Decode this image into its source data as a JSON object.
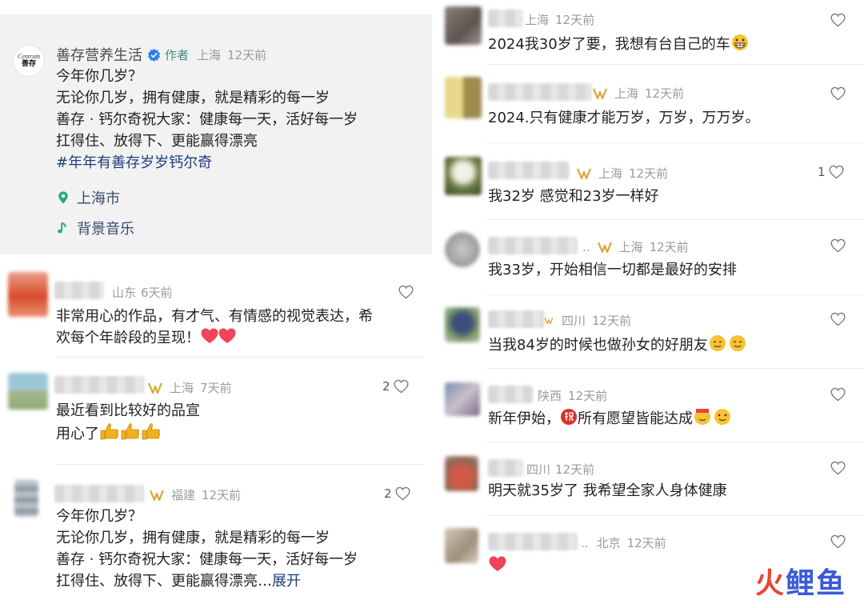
{
  "post": {
    "brand_logo": {
      "line1": "Centrum",
      "line2": "善存"
    },
    "author_name": "善存营养生活",
    "author_tag": "作者",
    "region": "上海",
    "time": "12天前",
    "lines": [
      "今年你几岁？",
      "无论你几岁，拥有健康，就是精彩的每一岁",
      "善存 · 钙尔奇祝大家：健康每一天，活好每一岁",
      "扛得住、放得下、更能赢得漂亮"
    ],
    "hashtag": "#年年有善存岁岁钙尔奇",
    "location": "上海市",
    "music": "背景音乐"
  },
  "left_comments": [
    {
      "region": "山东",
      "time": "6天前",
      "lines": [
        "非常用心的作品，有才气、有情感的视觉表达，希",
        "欢每个年龄段的呈现！"
      ],
      "likes": ""
    },
    {
      "region": "上海",
      "time": "7天前",
      "lines": [
        "最近看到比较好的品宣",
        "用心了"
      ],
      "likes": "2"
    },
    {
      "region": "福建",
      "time": "12天前",
      "lines": [
        "今年你几岁？",
        "无论你几岁，拥有健康，就是精彩的每一岁",
        "善存 · 钙尔奇祝大家：健康每一天，活好每一岁",
        "扛得住、放得下、更能赢得漂亮…"
      ],
      "expand": "展开",
      "likes": "2"
    }
  ],
  "right_comments": [
    {
      "region": "上海",
      "time": "12天前",
      "text": "2024我30岁了要，我想有台自己的车",
      "likes": ""
    },
    {
      "region": "上海",
      "time": "12天前",
      "text": "2024.只有健康才能万岁，万岁，万万岁。",
      "likes": ""
    },
    {
      "region": "上海",
      "time": "12天前",
      "text": "我32岁 感觉和23岁一样好",
      "likes": "1"
    },
    {
      "region": "上海",
      "time": "12天前",
      "prefix": "..",
      "text": "我33岁，开始相信一切都是最好的安排",
      "likes": ""
    },
    {
      "region": "四川",
      "time": "12天前",
      "text": "当我84岁的时候也做孙女的好朋友",
      "likes": ""
    },
    {
      "region": "陕西",
      "time": "12天前",
      "text_a": "新年伊始，",
      "text_b": "所有愿望皆能达成",
      "likes": ""
    },
    {
      "region": "四川",
      "time": "12天前",
      "text": "明天就35岁了 我希望全家人身体健康",
      "likes": ""
    },
    {
      "region": "北京",
      "time": "12天前",
      "prefix": "..",
      "text": "",
      "likes": ""
    }
  ],
  "watermark": {
    "fire": "火",
    "rest": "鲤鱼"
  },
  "colors": {
    "card_bg": "#f2f2f3",
    "meta": "#9a9a9a",
    "link": "#1f3d7a",
    "author_tag": "#3f8f7f",
    "badge": "#d9a53a",
    "heart_red": "#f0445a"
  }
}
